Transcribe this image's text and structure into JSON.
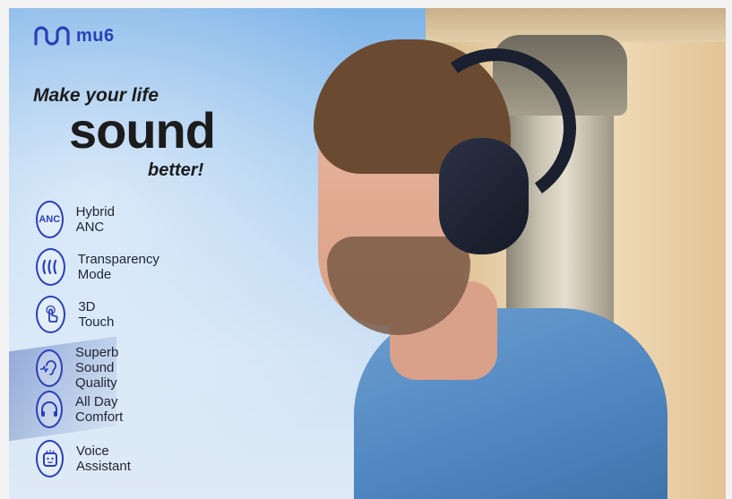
{
  "brand": {
    "name": "mu6",
    "color": "#2a3fb8"
  },
  "headline": {
    "line1": "Make your life",
    "line2": "sound",
    "line3": "better!"
  },
  "features": [
    {
      "icon": "anc-icon",
      "badge": "ANC",
      "label": "Hybrid ANC"
    },
    {
      "icon": "transparency-icon",
      "label": "Transparency Mode"
    },
    {
      "icon": "touch-icon",
      "label": "3D Touch"
    },
    {
      "icon": "ear-sound-icon",
      "label": "Superb Sound Quality"
    },
    {
      "icon": "headphones-icon",
      "label": "All Day Comfort"
    },
    {
      "icon": "voice-assistant-icon",
      "label": "Voice Assistant"
    }
  ]
}
